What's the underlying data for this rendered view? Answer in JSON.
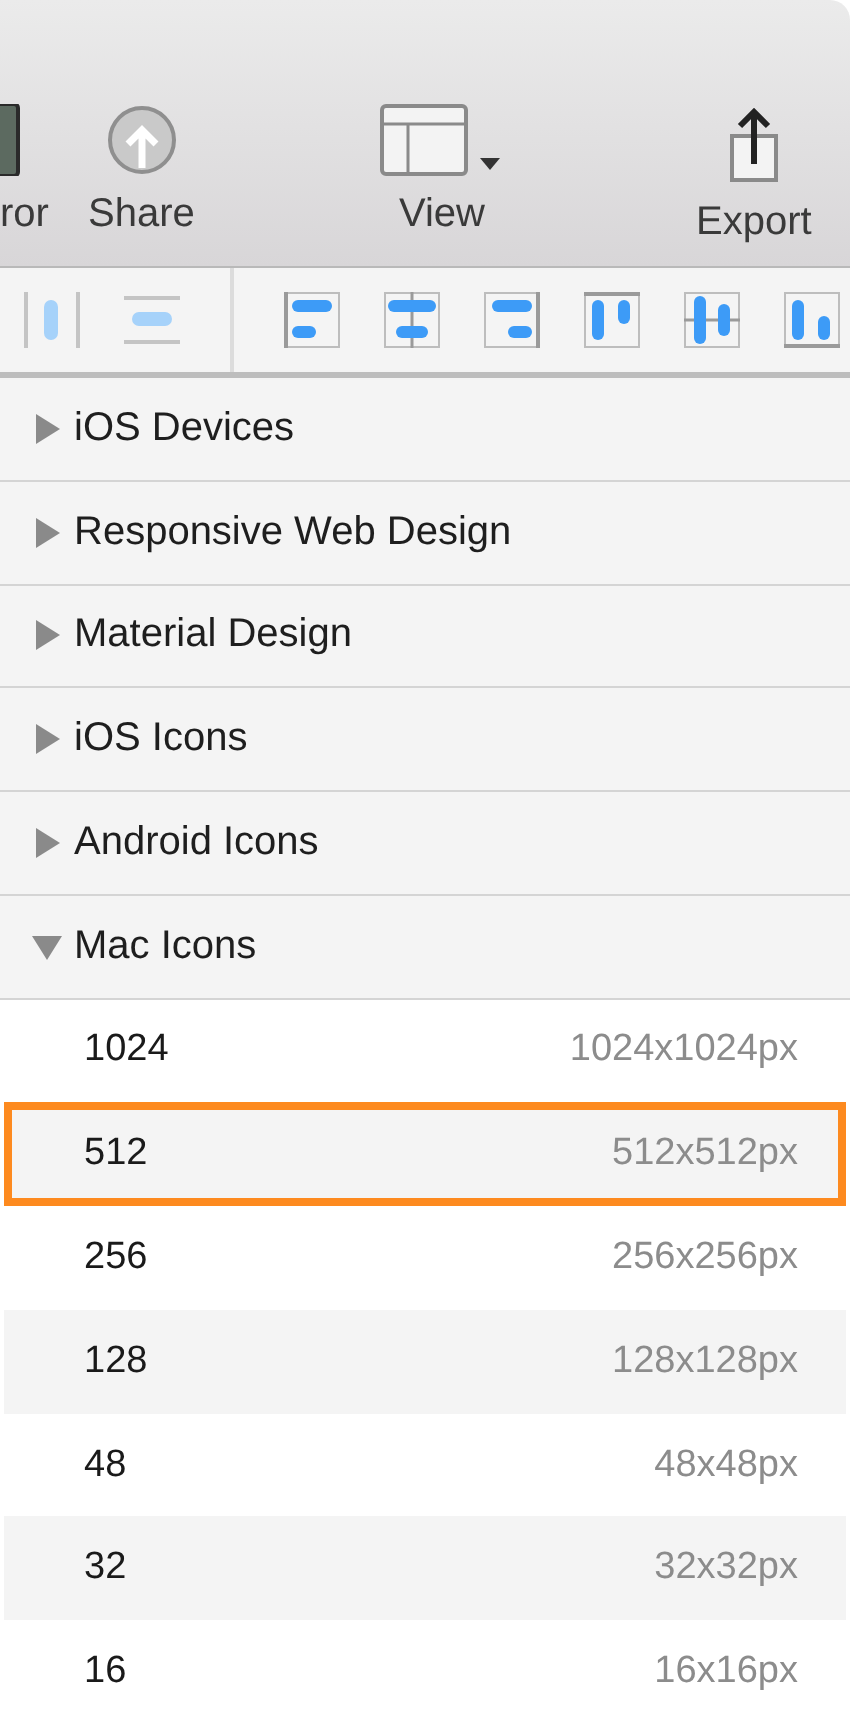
{
  "toolbar": [
    {
      "kind": "device",
      "label": "ror"
    },
    {
      "kind": "share",
      "label": "Share"
    },
    {
      "kind": "view",
      "label": "View"
    },
    {
      "kind": "export",
      "label": "Export"
    }
  ],
  "align_tools": [
    {
      "kind": "distribute-h",
      "disabled": true
    },
    {
      "kind": "distribute-v",
      "disabled": true
    },
    {
      "kind": "left",
      "disabled": false
    },
    {
      "kind": "center-h",
      "disabled": false
    },
    {
      "kind": "right",
      "disabled": false
    },
    {
      "kind": "top",
      "disabled": false
    },
    {
      "kind": "middle-v",
      "disabled": false
    },
    {
      "kind": "bottom",
      "disabled": false
    }
  ],
  "groups": [
    {
      "label": "iOS Devices",
      "expanded": false
    },
    {
      "label": "Responsive Web Design",
      "expanded": false
    },
    {
      "label": "Material Design",
      "expanded": false
    },
    {
      "label": "iOS Icons",
      "expanded": false
    },
    {
      "label": "Android Icons",
      "expanded": false
    },
    {
      "label": "Mac Icons",
      "expanded": true,
      "children": [
        {
          "name": "1024",
          "size": "1024x1024px",
          "selected": false
        },
        {
          "name": "512",
          "size": "512x512px",
          "selected": true
        },
        {
          "name": "256",
          "size": "256x256px",
          "selected": false
        },
        {
          "name": "128",
          "size": "128x128px",
          "selected": false
        },
        {
          "name": "48",
          "size": "48x48px",
          "selected": false
        },
        {
          "name": "32",
          "size": "32x32px",
          "selected": false
        },
        {
          "name": "16",
          "size": "16x16px",
          "selected": false
        }
      ]
    }
  ]
}
